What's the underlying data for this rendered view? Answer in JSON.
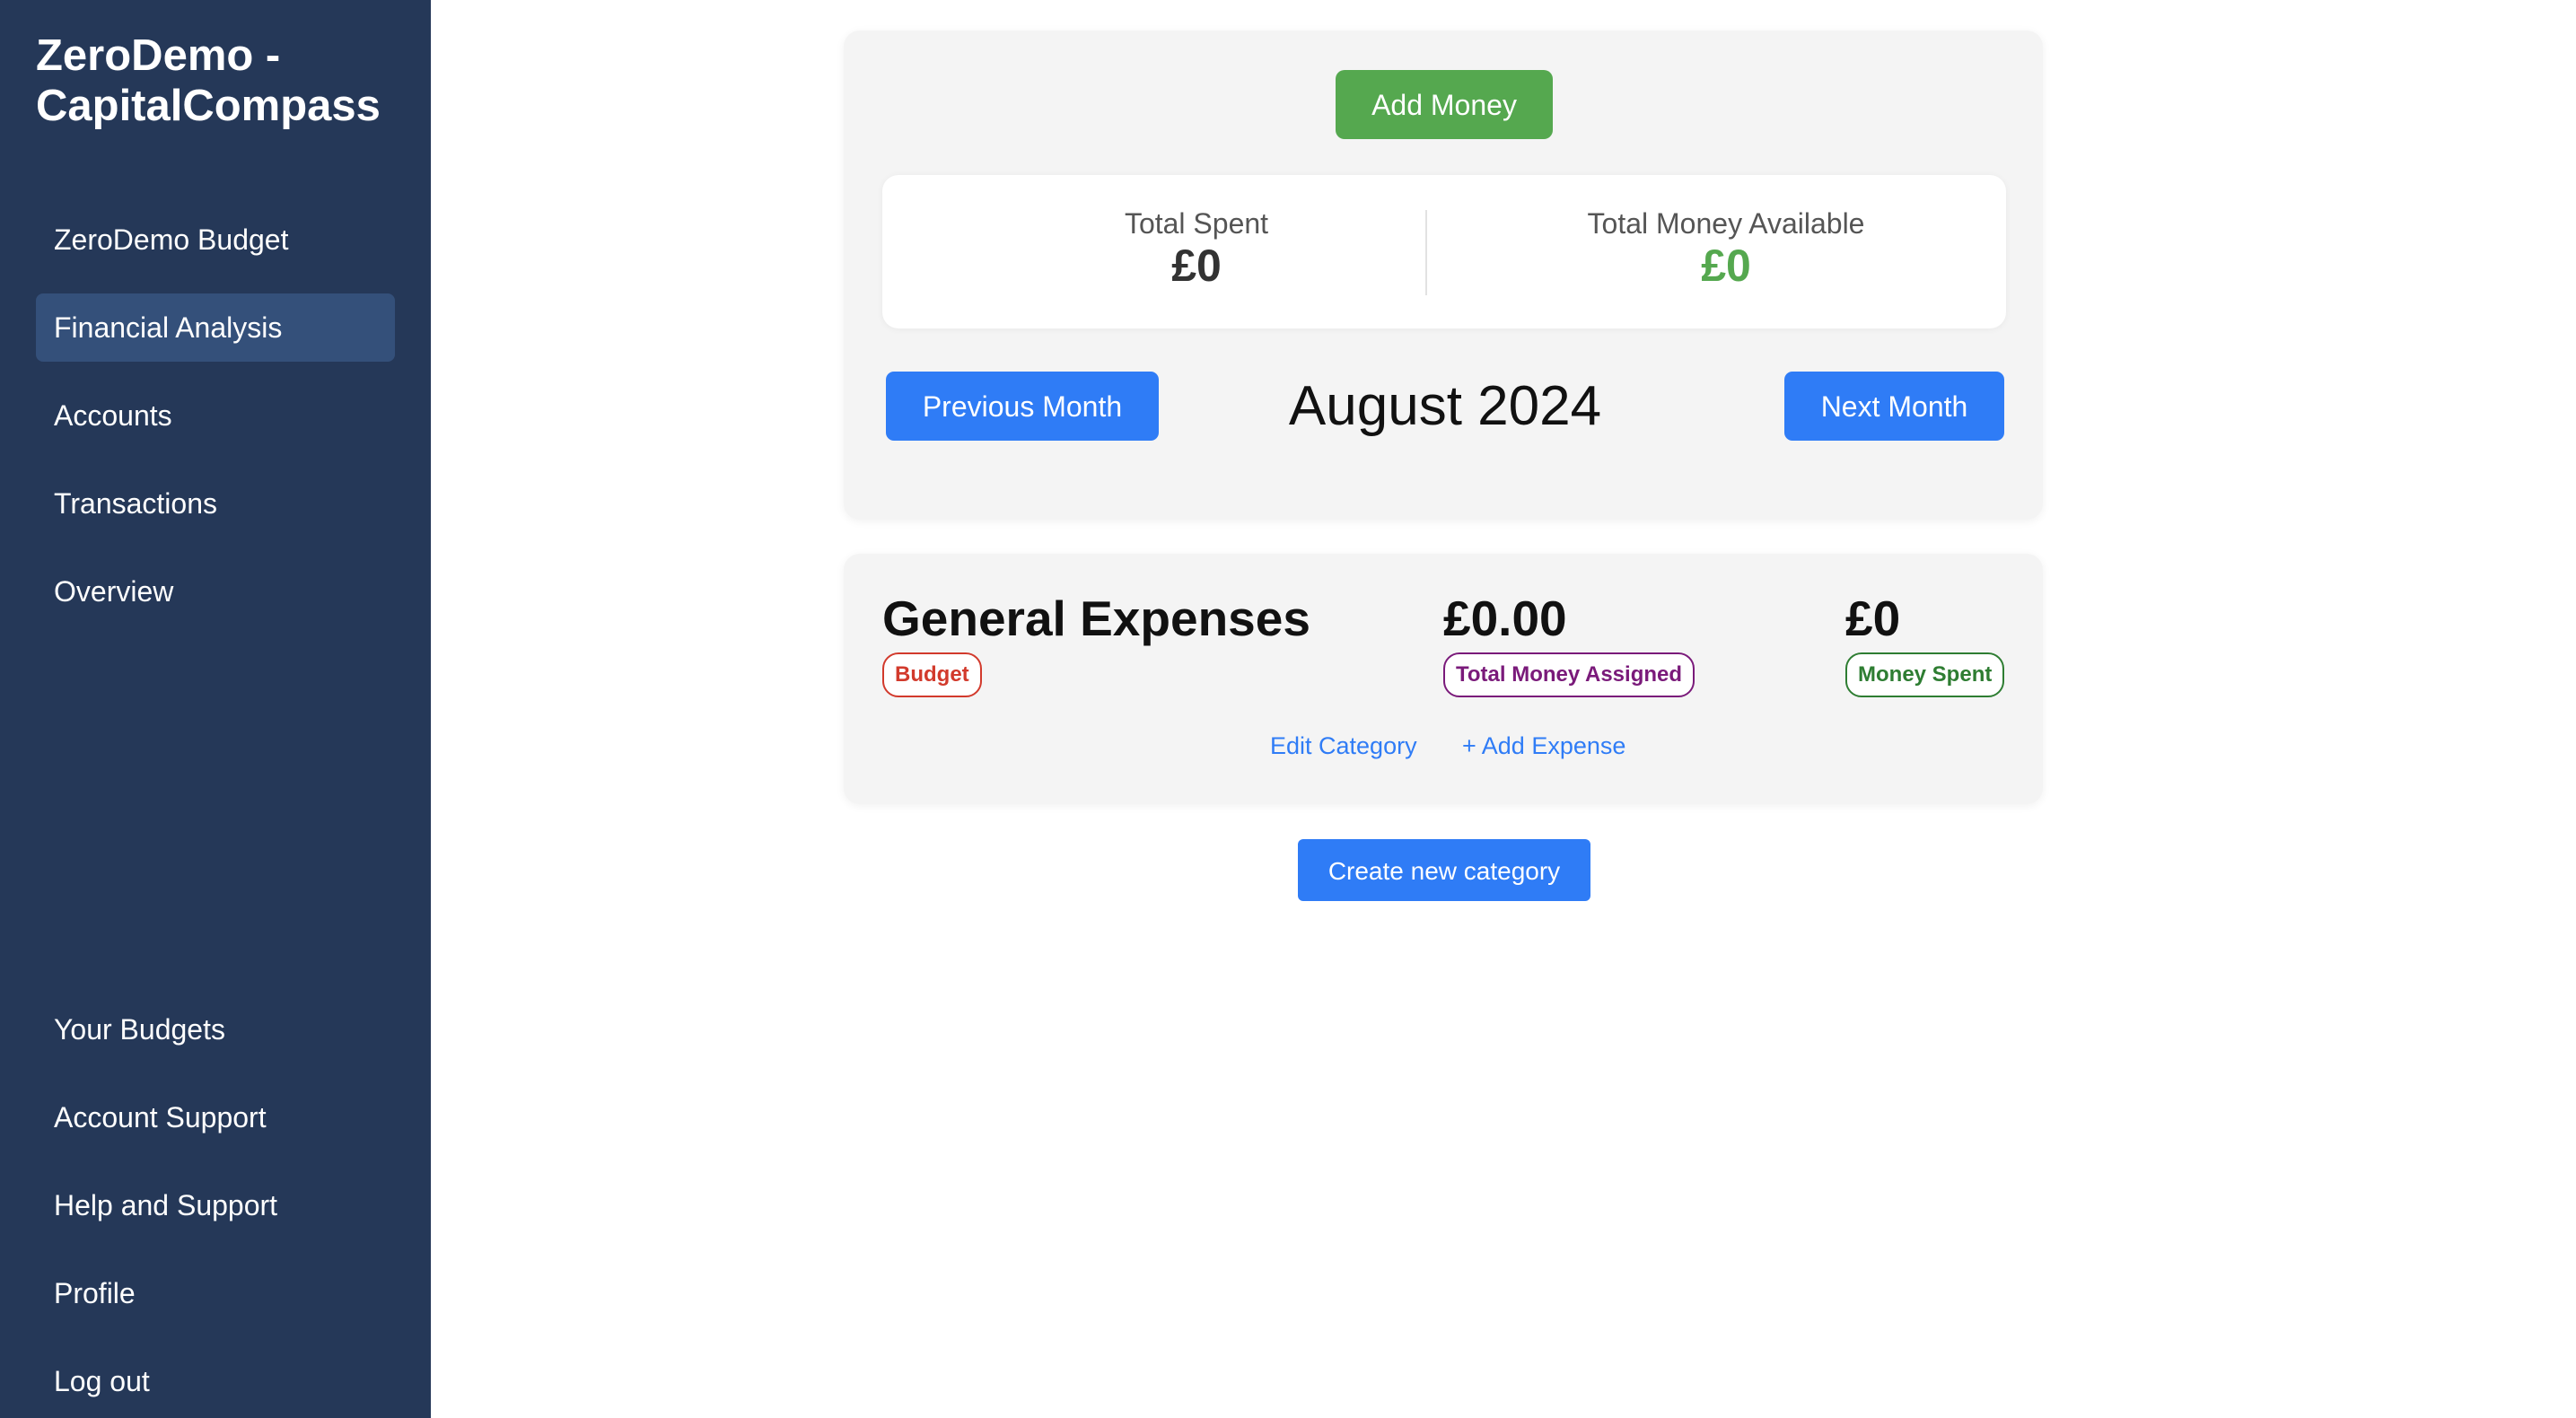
{
  "sidebar": {
    "brand": "ZeroDemo - CapitalCompass",
    "top_items": [
      {
        "label": "ZeroDemo Budget"
      },
      {
        "label": "Financial Analysis"
      },
      {
        "label": "Accounts"
      },
      {
        "label": "Transactions"
      },
      {
        "label": "Overview"
      }
    ],
    "bottom_items": [
      {
        "label": "Your Budgets"
      },
      {
        "label": "Account Support"
      },
      {
        "label": "Help and Support"
      },
      {
        "label": "Profile"
      },
      {
        "label": "Log out"
      }
    ]
  },
  "budget": {
    "add_money_label": "Add Money",
    "total_spent_label": "Total Spent",
    "total_spent_value": "£0",
    "total_available_label": "Total Money Available",
    "total_available_value": "£0",
    "prev_month_label": "Previous Month",
    "next_month_label": "Next Month",
    "current_month": "August 2024"
  },
  "category": {
    "name": "General Expenses",
    "type_badge": "Budget",
    "assigned_value": "£0.00",
    "assigned_label": "Total Money Assigned",
    "spent_value": "£0",
    "spent_label": "Money Spent",
    "edit_label": "Edit Category",
    "add_expense_label": "+ Add Expense"
  },
  "create_category_label": "Create new category",
  "colors": {
    "sidebar_bg": "#253858",
    "sidebar_active": "#34507a",
    "primary_blue": "#2f7cf6",
    "success_green": "#55a84f",
    "badge_red": "#d23a2c",
    "badge_purple": "#7a1a7a",
    "badge_green": "#2e7d32"
  }
}
